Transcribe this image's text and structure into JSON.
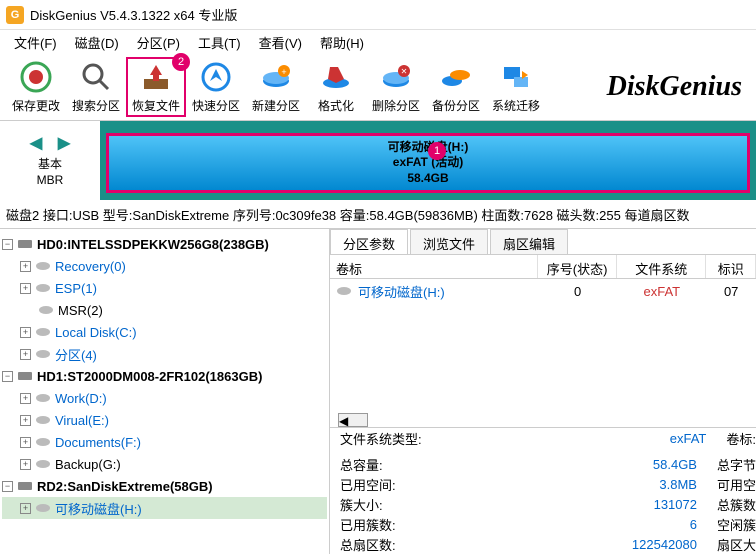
{
  "titlebar": {
    "logo_text": "G",
    "title": "DiskGenius V5.4.3.1322 x64 专业版"
  },
  "menu": [
    "文件(F)",
    "磁盘(D)",
    "分区(P)",
    "工具(T)",
    "查看(V)",
    "帮助(H)"
  ],
  "toolbar": [
    {
      "label": "保存更改",
      "name": "save-changes"
    },
    {
      "label": "搜索分区",
      "name": "search-partition"
    },
    {
      "label": "恢复文件",
      "name": "recover-files",
      "highlighted": true,
      "badge": "2"
    },
    {
      "label": "快速分区",
      "name": "quick-partition"
    },
    {
      "label": "新建分区",
      "name": "new-partition"
    },
    {
      "label": "格式化",
      "name": "format"
    },
    {
      "label": "删除分区",
      "name": "delete-partition"
    },
    {
      "label": "备份分区",
      "name": "backup-partition"
    },
    {
      "label": "系统迁移",
      "name": "system-migration"
    }
  ],
  "brand": "DiskGenius",
  "disk_strip": {
    "basic": "基本",
    "mbr": "MBR",
    "partition_name": "可移动磁盘(H:)",
    "partition_fs": "exFAT (活动)",
    "partition_size": "58.4GB",
    "badge": "1"
  },
  "info_bar": "磁盘2 接口:USB 型号:SanDiskExtreme 序列号:0c309fe38 容量:58.4GB(59836MB) 柱面数:7628 磁头数:255 每道扇区数",
  "tree": {
    "hd0": {
      "label": "HD0:INTELSSDPEKKW256G8(238GB)"
    },
    "hd0_children": [
      {
        "label": "Recovery(0)",
        "link": true
      },
      {
        "label": "ESP(1)",
        "link": true
      },
      {
        "label": "MSR(2)"
      },
      {
        "label": "Local Disk(C:)",
        "link": true
      },
      {
        "label": "分区(4)",
        "link": true
      }
    ],
    "hd1": {
      "label": "HD1:ST2000DM008-2FR102(1863GB)"
    },
    "hd1_children": [
      {
        "label": "Work(D:)",
        "link": true
      },
      {
        "label": "Virual(E:)",
        "link": true
      },
      {
        "label": "Documents(F:)",
        "link": true
      },
      {
        "label": "Backup(G:)"
      }
    ],
    "rd2": {
      "label": "RD2:SanDiskExtreme(58GB)"
    },
    "rd2_children": [
      {
        "label": "可移动磁盘(H:)",
        "link": true,
        "selected": true
      }
    ]
  },
  "tabs": [
    "分区参数",
    "浏览文件",
    "扇区编辑"
  ],
  "table": {
    "headers": [
      "卷标",
      "序号(状态)",
      "文件系统",
      "标识"
    ],
    "row": {
      "label": "可移动磁盘(H:)",
      "seq": "0",
      "fs": "exFAT",
      "flag": "07"
    }
  },
  "details": {
    "fs_type_label": "文件系统类型:",
    "fs_type_value": "exFAT",
    "vol_label": "卷标:",
    "rows": [
      {
        "label": "总容量:",
        "value": "58.4GB",
        "extra": "总字节"
      },
      {
        "label": "已用空间:",
        "value": "3.8MB",
        "extra": "可用空"
      },
      {
        "label": "簇大小:",
        "value": "131072",
        "extra": "总簇数"
      },
      {
        "label": "已用簇数:",
        "value": "6",
        "extra": "空闲簇"
      },
      {
        "label": "总扇区数:",
        "value": "122542080",
        "extra": "扇区大"
      }
    ]
  }
}
